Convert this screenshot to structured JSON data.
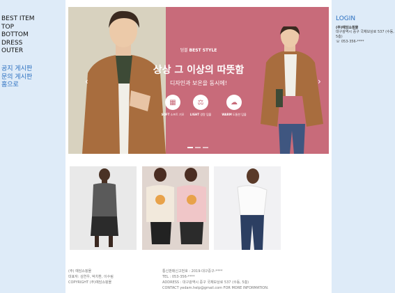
{
  "categories": [
    "BEST ITEM",
    "TOP",
    "BOTTOM",
    "DRESS",
    "OUTER"
  ],
  "boards": [
    "공지 게시판",
    "문의 게시판",
    "홈으로"
  ],
  "login": "LOGIN",
  "company": {
    "name": "(주)예담쇼핑몰",
    "address": "대구광역시 중구 국채보상로 537 (수동, 5층)",
    "phone": "☏ 053-356-****"
  },
  "banner": {
    "brand": "덤블",
    "tag": "BEST STYLE",
    "title": "상상 그 이상의 따뜻함",
    "subtitle": "디자인과 보온을 동시에!",
    "features": [
      {
        "icon": "grid-icon",
        "name": "SOFT",
        "desc": "소프트 기모"
      },
      {
        "icon": "weight-icon",
        "name": "LIGHT",
        "desc": "경량 덤블"
      },
      {
        "icon": "warm-icon",
        "name": "WARM",
        "desc": "도톰한 덤블"
      }
    ],
    "slide_count": 3,
    "active_slide": 0
  },
  "products": [
    {
      "name": "black-turtleneck-skirt-look"
    },
    {
      "name": "pastel-sweatshirt-look"
    },
    {
      "name": "white-blouse-jeans-look"
    }
  ],
  "footer": {
    "left": [
      "(주) 예담쇼핑몰",
      "대표자: 김연우, 박치환, 이수림",
      "COPYRIGHT (주)예담쇼핑몰"
    ],
    "right": [
      "통신판매신고번호 : 2019-대구중구-****",
      "TEL : 053-356-****",
      "ADDRESS : 대구광역시 중구 국채보상로 537 (수동, 5층)",
      "CONTACT yedam.help@gmail.com FOR MORE INFORMATION."
    ]
  },
  "colors": {
    "side_panel": "#deebf8",
    "accent": "#2a6fc0",
    "banner_pink": "#c86b7a",
    "banner_beige": "#d8d2bf"
  }
}
